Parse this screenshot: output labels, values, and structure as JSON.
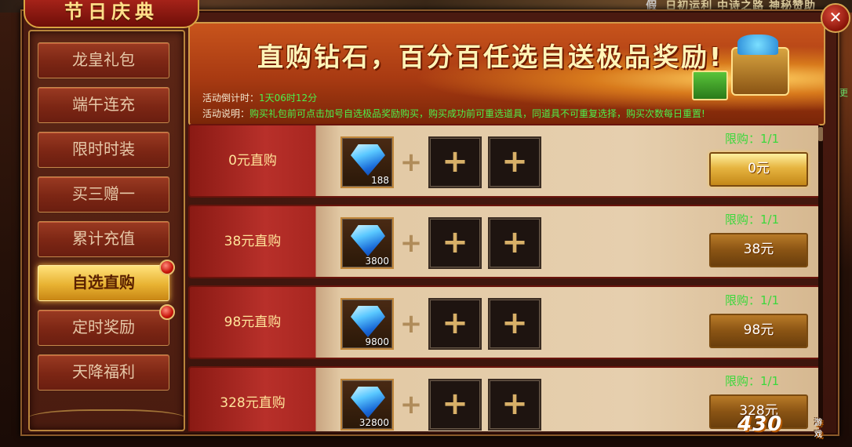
{
  "top_ticker": {
    "left": "假",
    "text": "日初运利 中诗之路 神秘赞助"
  },
  "title": "节日庆典",
  "close_label": "✕",
  "sidebar": {
    "items": [
      {
        "label": "龙皇礼包",
        "active": false,
        "dot": false
      },
      {
        "label": "端午连充",
        "active": false,
        "dot": false
      },
      {
        "label": "限时时装",
        "active": false,
        "dot": false
      },
      {
        "label": "买三赠一",
        "active": false,
        "dot": false
      },
      {
        "label": "累计充值",
        "active": false,
        "dot": false
      },
      {
        "label": "自选直购",
        "active": true,
        "dot": true
      },
      {
        "label": "定时奖励",
        "active": false,
        "dot": true
      },
      {
        "label": "天降福利",
        "active": false,
        "dot": false
      }
    ]
  },
  "banner": {
    "headline": "直购钻石，百分百任选自送极品奖励!",
    "countdown_label": "活动倒计时：",
    "countdown_value": "1天06时12分",
    "desc_label": "活动说明：",
    "desc_value": "购买礼包前可点击加号自选极品奖励购买，购买成功前可重选道具，同道具不可重复选择，购买次数每日重置!"
  },
  "packages": [
    {
      "name": "0元直购",
      "qty": "188",
      "limit": "限购：1/1",
      "buy": "0元",
      "highlight": true
    },
    {
      "name": "38元直购",
      "qty": "3800",
      "limit": "限购：1/1",
      "buy": "38元",
      "highlight": false
    },
    {
      "name": "98元直购",
      "qty": "9800",
      "limit": "限购：1/1",
      "buy": "98元",
      "highlight": false
    },
    {
      "name": "328元直购",
      "qty": "32800",
      "limit": "限购：1/1",
      "buy": "328元",
      "highlight": false
    }
  ],
  "plus_symbol": "+",
  "logo": {
    "text": "430",
    "sub": "游戏"
  },
  "side_text": "更",
  "colors": {
    "accent_gold": "#e6b440",
    "limit_green": "#3cd83c",
    "countdown_green": "#4cf04c"
  }
}
